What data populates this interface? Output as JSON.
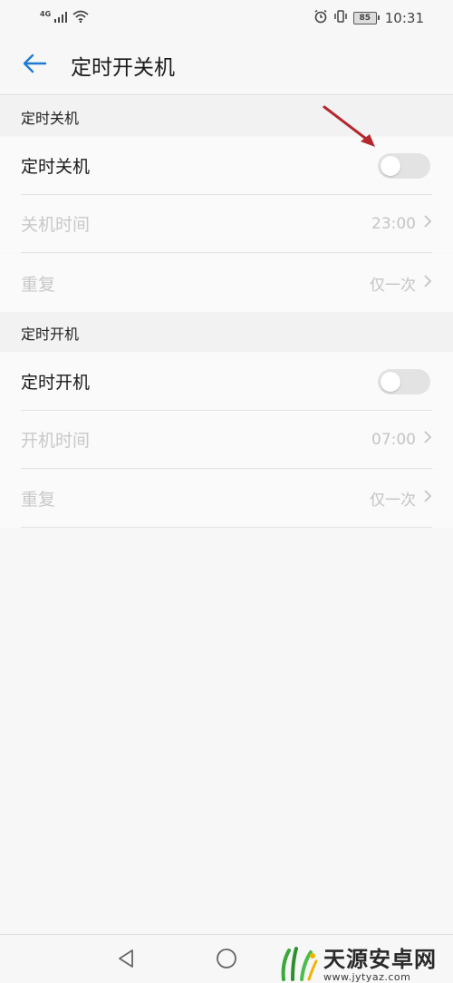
{
  "status_bar": {
    "network": "4G",
    "battery": "85",
    "time": "10:31"
  },
  "header": {
    "title": "定时开关机"
  },
  "shutdown_section": {
    "title": "定时关机",
    "toggle_label": "定时关机",
    "toggle_on": false,
    "time_label": "关机时间",
    "time_value": "23:00",
    "repeat_label": "重复",
    "repeat_value": "仅一次"
  },
  "boot_section": {
    "title": "定时开机",
    "toggle_label": "定时开机",
    "toggle_on": false,
    "time_label": "开机时间",
    "time_value": "07:00",
    "repeat_label": "重复",
    "repeat_value": "仅一次"
  },
  "watermark": {
    "name": "天源安卓网",
    "url": "www.jytyaz.com"
  },
  "colors": {
    "accent": "#1e7ad6",
    "annotation_arrow": "#b3272d",
    "toggle_off": "#e3e3e3",
    "disabled_text": "#c8c8c8"
  },
  "icons": {
    "back": "arrow-left-icon",
    "chevron": "chevron-right-icon",
    "nav_back": "triangle-back-icon",
    "nav_home": "circle-home-icon"
  }
}
